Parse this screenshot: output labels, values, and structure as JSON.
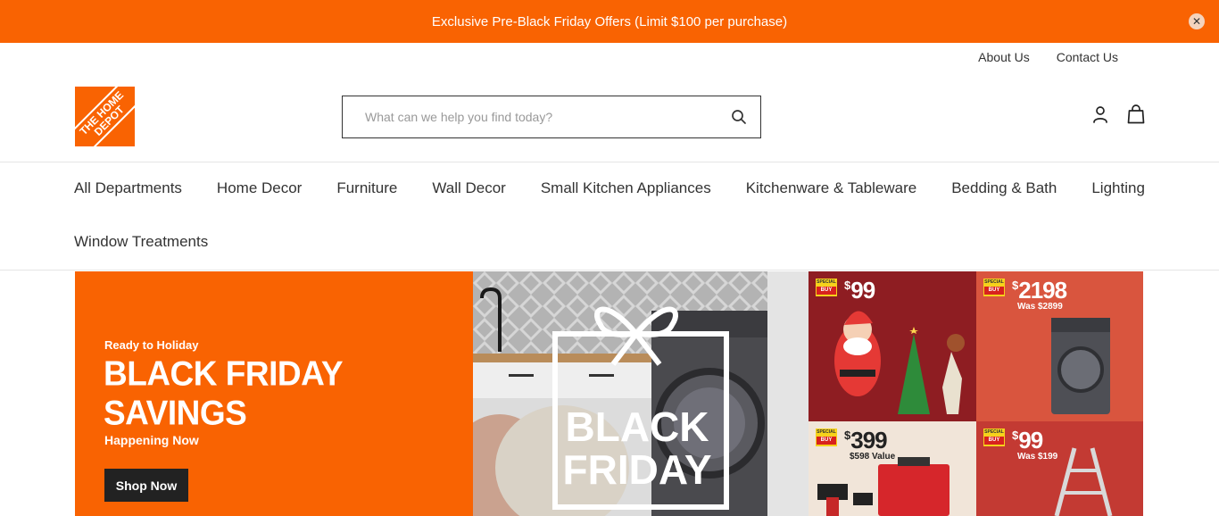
{
  "promo": {
    "text": "Exclusive Pre-Black Friday Offers (Limit $100 per purchase)",
    "close_symbol": "✕"
  },
  "utility_links": [
    "About Us",
    "Contact Us"
  ],
  "logo": {
    "text": "THE HOME DEPOT",
    "color": "#f96302"
  },
  "search": {
    "placeholder": "What can we help you find today?",
    "value": ""
  },
  "header_icons": [
    "account-icon",
    "shopping-bag-icon"
  ],
  "nav": {
    "row1": [
      "All Departments",
      "Home Decor",
      "Furniture",
      "Wall Decor",
      "Small Kitchen Appliances",
      "Kitchenware & Tableware",
      "Bedding & Bath",
      "Lighting"
    ],
    "row2": [
      "Window Treatments"
    ]
  },
  "hero": {
    "eyebrow": "Ready to Holiday",
    "title": "BLACK FRIDAY\nSAVINGS",
    "subtitle": "Happening Now",
    "button": "Shop Now",
    "image_text_line1": "BLACK",
    "image_text_line2": "FRIDAY"
  },
  "deals": [
    {
      "badge_top": "SPECIAL",
      "badge_bottom": "BUY",
      "currency": "$",
      "price": "99",
      "note": "",
      "item": "santa-decor"
    },
    {
      "badge_top": "SPECIAL",
      "badge_bottom": "BUY",
      "currency": "$",
      "price": "2198",
      "note": "Was $2899",
      "item": "washer-dryer"
    },
    {
      "badge_top": "SPECIAL",
      "badge_bottom": "BUY",
      "currency": "$",
      "price": "399",
      "note": "$598 Value",
      "item": "power-tool-kit"
    },
    {
      "badge_top": "SPECIAL",
      "badge_bottom": "BUY",
      "currency": "$",
      "price": "99",
      "note": "Was $199",
      "item": "ladder"
    }
  ],
  "colors": {
    "brand_orange": "#f96302",
    "dark": "#222222"
  }
}
